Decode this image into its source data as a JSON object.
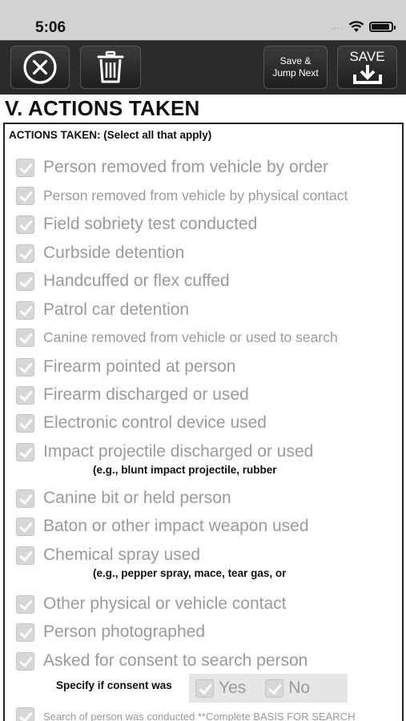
{
  "status_bar": {
    "time": "5:06",
    "signal": "....",
    "icons": [
      "wifi-icon",
      "battery-icon"
    ]
  },
  "toolbar": {
    "close_icon": "close-circle-icon",
    "delete_icon": "trash-icon",
    "jump_label_line1": "Save &",
    "jump_label_line2": "Jump Next",
    "save_label": "SAVE",
    "save_icon": "download-icon"
  },
  "section": {
    "title": "V. ACTIONS TAKEN",
    "header": "ACTIONS TAKEN: (Select all that apply)"
  },
  "options": [
    {
      "label": "Person removed from vehicle by order",
      "checked": true
    },
    {
      "label": "Person removed from vehicle by physical contact",
      "checked": true
    },
    {
      "label": "Field sobriety test conducted",
      "checked": true
    },
    {
      "label": "Curbside detention",
      "checked": true
    },
    {
      "label": "Handcuffed or flex cuffed",
      "checked": true
    },
    {
      "label": "Patrol car detention",
      "checked": true
    },
    {
      "label": "Canine removed from vehicle or used to search",
      "checked": true
    },
    {
      "label": "Firearm pointed at person",
      "checked": true
    },
    {
      "label": "Firearm discharged or used",
      "checked": true
    },
    {
      "label": "Electronic control device used",
      "checked": true
    },
    {
      "label": "Impact projectile discharged or used",
      "checked": true,
      "note": "(e.g., blunt impact projectile, rubber"
    },
    {
      "label": "Canine bit or held person",
      "checked": true
    },
    {
      "label": "Baton or other impact weapon used",
      "checked": true
    },
    {
      "label": "Chemical spray used",
      "checked": true,
      "note": "(e.g., pepper spray, mace, tear gas, or"
    },
    {
      "label": "Other physical or vehicle contact",
      "checked": true
    },
    {
      "label": "Person photographed",
      "checked": true
    },
    {
      "label": "Asked for consent to search person",
      "checked": true
    },
    {
      "label": "Search of person was conducted **Complete BASIS FOR SEARCH",
      "checked": true
    }
  ],
  "consent": {
    "specify_label": "Specify if consent was",
    "yes_label": "Yes",
    "no_label": "No"
  },
  "colors": {
    "toolbar_bg": "#2b2b2b",
    "status_bg": "#d2d2d2",
    "disabled_text": "#9a9a9a",
    "checkbox_fill": "#d7d7d7"
  }
}
